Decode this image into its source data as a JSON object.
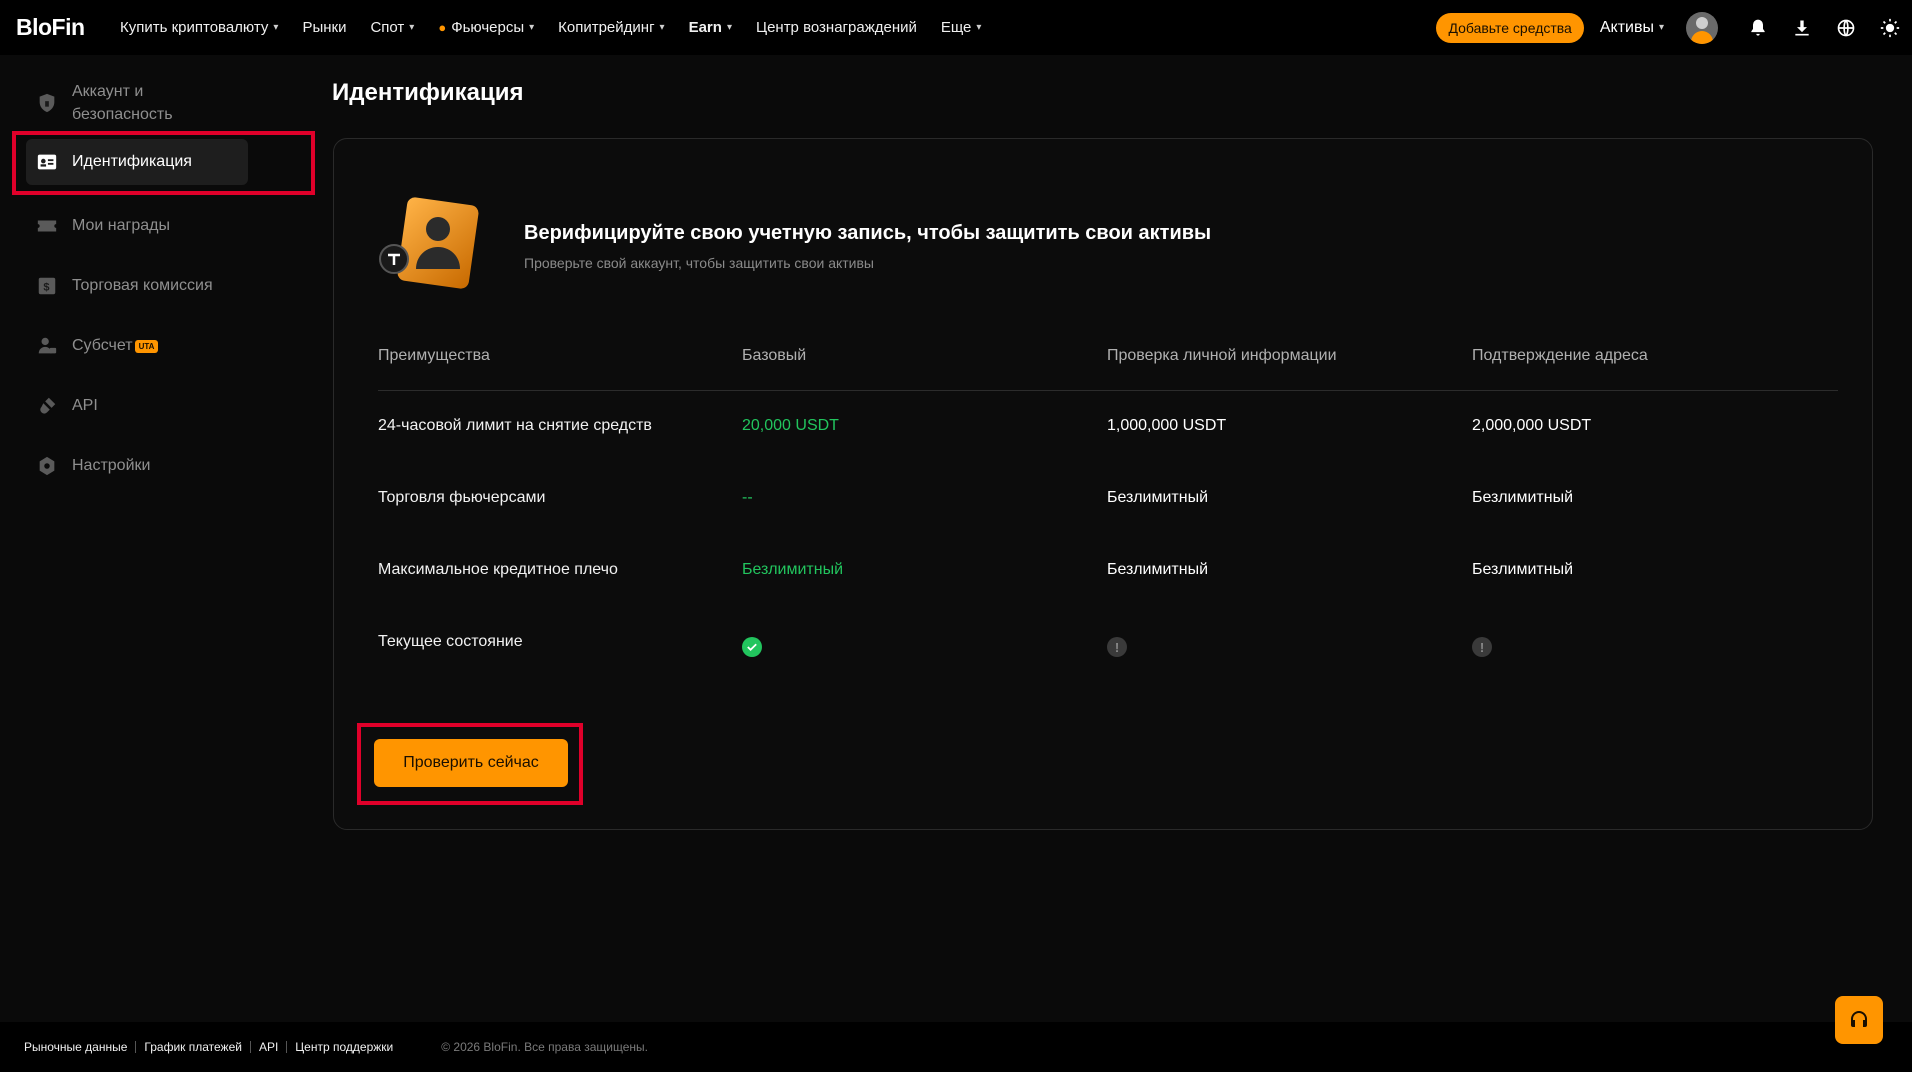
{
  "brand": {
    "logo_text": "BloFin"
  },
  "nav": {
    "items": [
      {
        "label": "Купить криптовалюту",
        "has_dropdown": true
      },
      {
        "label": "Рынки",
        "has_dropdown": false
      },
      {
        "label": "Спот",
        "has_dropdown": true
      },
      {
        "label": "Фьючерсы",
        "has_dropdown": true
      },
      {
        "label": "Копитрейдинг",
        "has_dropdown": true
      },
      {
        "label": "Earn",
        "has_dropdown": true
      },
      {
        "label": "Центр вознаграждений",
        "has_dropdown": false
      },
      {
        "label": "Еще",
        "has_dropdown": true
      }
    ],
    "chevron": "⌄",
    "futures_icon": "fire-icon"
  },
  "topbar": {
    "deposit_label": "Добавьте средства",
    "assets_label": "Активы",
    "icons": [
      "user-avatar",
      "bell-icon",
      "download-icon",
      "globe-icon",
      "sun-icon"
    ]
  },
  "sidebar": {
    "items": [
      {
        "label": "Аккаунт и безопасность",
        "icon": "shield-icon",
        "active": false
      },
      {
        "label": "Идентификация",
        "icon": "id-card-icon",
        "active": true
      },
      {
        "label": "Мои награды",
        "icon": "ticket-icon",
        "active": false
      },
      {
        "label": "Торговая комиссия",
        "icon": "dollar-doc-icon",
        "active": false
      },
      {
        "label": "Субсчет",
        "icon": "sub-account-icon",
        "active": false,
        "badge": "UTA"
      },
      {
        "label": "API",
        "icon": "plug-icon",
        "active": false
      },
      {
        "label": "Настройки",
        "icon": "settings-icon",
        "active": false
      }
    ]
  },
  "page": {
    "title": "Идентификация"
  },
  "hero": {
    "title": "Верифицируйте свою учетную запись, чтобы защитить свои активы",
    "subtitle": "Проверьте свой аккаунт, чтобы защитить свои активы"
  },
  "table": {
    "headers": [
      "Преимущества",
      "Базовый",
      "Проверка личной информации",
      "Подтверждение адреса"
    ],
    "rows": [
      {
        "label": "24-часовой лимит на снятие средств",
        "basic": "20,000 USDT",
        "personal": "1,000,000 USDT",
        "address": "2,000,000 USDT"
      },
      {
        "label": "Торговля фьючерсами",
        "basic": "--",
        "personal": "Безлимитный",
        "address": "Безлимитный"
      },
      {
        "label": "Максимальное кредитное плечо",
        "basic": "Безлимитный",
        "personal": "Безлимитный",
        "address": "Безлимитный"
      },
      {
        "label": "Текущее состояние",
        "basic_status": "verified",
        "personal_status": "pending",
        "address_status": "pending"
      }
    ]
  },
  "cta": {
    "verify_label": "Проверить сейчас"
  },
  "footer": {
    "links": [
      "Рыночные данные",
      "График платежей",
      "API",
      "Центр поддержки"
    ],
    "copyright": "© 2026 BloFin. Все права защищены."
  },
  "colors": {
    "accent": "#ff9500",
    "success": "#22c55e",
    "highlight": "#e0002a",
    "background": "#0a0a0a"
  }
}
